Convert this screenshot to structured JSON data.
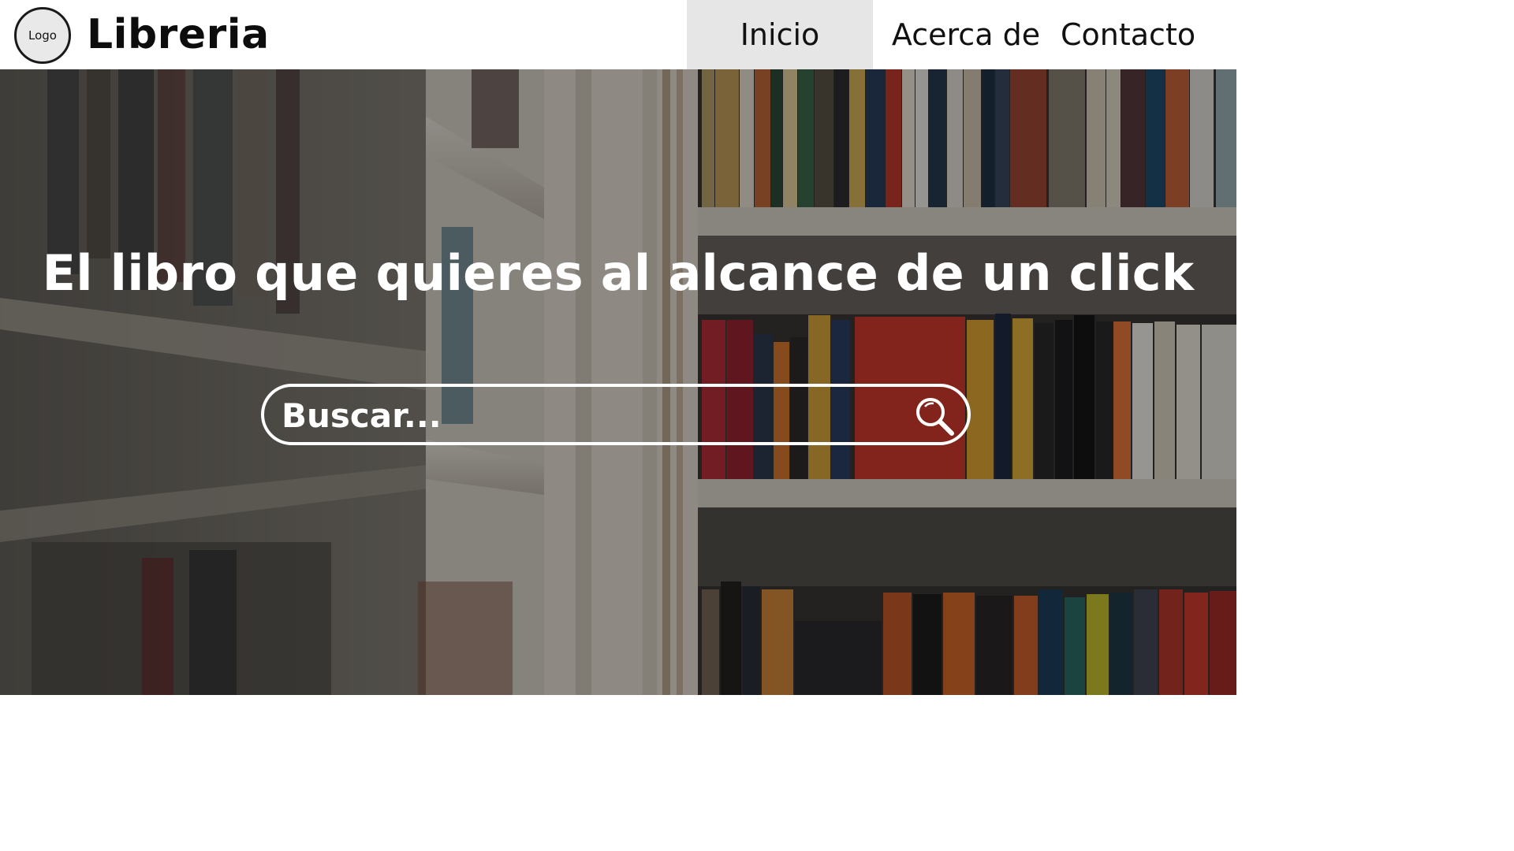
{
  "header": {
    "logo_text": "Logo",
    "brand": "Libreria",
    "nav": [
      {
        "label": "Inicio",
        "active": true
      },
      {
        "label": "Acerca de",
        "active": false
      },
      {
        "label": "Contacto",
        "active": false
      }
    ]
  },
  "hero": {
    "title": "El libro que quieres al alcance de un click",
    "background": "bookshelf-photo",
    "search": {
      "placeholder": "Buscar...",
      "icon": "search-icon"
    }
  },
  "colors": {
    "header_bg": "#ffffff",
    "nav_active_bg": "#e6e6e6",
    "hero_text": "#ffffff"
  }
}
